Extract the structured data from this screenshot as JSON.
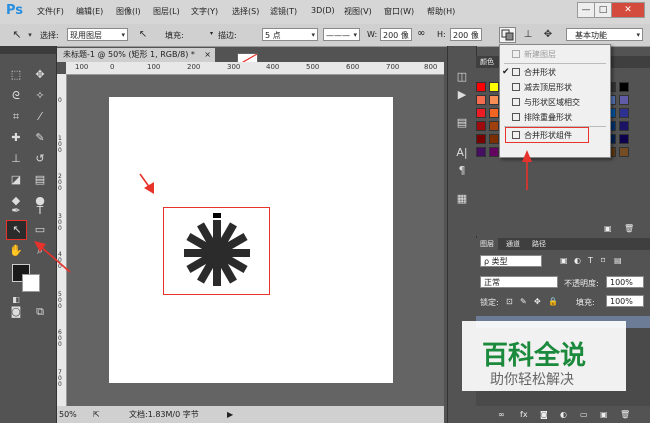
{
  "app": {
    "logo": "Ps"
  },
  "menubar": {
    "items": [
      "文件(F)",
      "编辑(E)",
      "图像(I)",
      "图层(L)",
      "文字(Y)",
      "选择(S)",
      "滤镜(T)",
      "3D(D)",
      "视图(V)",
      "窗口(W)",
      "帮助(H)"
    ],
    "window_controls": {
      "minimize": "—",
      "restore": "□",
      "close": "✕"
    }
  },
  "options_bar": {
    "select_label": "选择:",
    "select_value": "现用图层",
    "fill_label": "填充:",
    "stroke_label": "描边:",
    "stroke_size": "5 点",
    "stroke_style": "———",
    "w_label": "W:",
    "w_value": "200 像",
    "h_label": "H:",
    "h_value": "200 像",
    "workspace": "基本功能"
  },
  "path_ops_menu": {
    "items": [
      {
        "label": "新建图层",
        "disabled": true,
        "checked": false
      },
      {
        "label": "合并形状",
        "disabled": false,
        "checked": true
      },
      {
        "label": "减去顶层形状",
        "disabled": false,
        "checked": false
      },
      {
        "label": "与形状区域相交",
        "disabled": false,
        "checked": false
      },
      {
        "label": "排除重叠形状",
        "disabled": false,
        "checked": false
      },
      {
        "label": "合并形状组件",
        "disabled": false,
        "checked": false
      }
    ]
  },
  "document": {
    "tab_title": "未标题-1 @ 50% (矩形 1, RGB/8) *",
    "tab_close": "×",
    "ruler_top": [
      "100",
      "0",
      "100",
      "200",
      "300",
      "400",
      "500",
      "600",
      "700",
      "800"
    ],
    "ruler_left": [
      "0",
      "100",
      "200",
      "300",
      "400",
      "500",
      "600",
      "700"
    ],
    "zoom": "50%",
    "doc_info": "文档:1.83M/0 字节"
  },
  "swatches": {
    "tab_label": "颜色",
    "colors": [
      "#ff0000",
      "#ffff00",
      "#00ff00",
      "#00ffff",
      "#0000ff",
      "#ff00ff",
      "#ffffff",
      "#cccccc",
      "#999999",
      "#666666",
      "#333333",
      "#000000",
      "#f26c4f",
      "#f68e55",
      "#fbaf5c",
      "#fff467",
      "#acd372",
      "#7cc576",
      "#3bb878",
      "#1abbb4",
      "#00bff3",
      "#438cca",
      "#5574b9",
      "#605ca8",
      "#ed1c24",
      "#f26522",
      "#f7941d",
      "#fff200",
      "#8dc73f",
      "#39b54a",
      "#00a651",
      "#00a99d",
      "#00aeef",
      "#0072bc",
      "#0054a6",
      "#2e3192",
      "#9e0b0f",
      "#a0410d",
      "#a3620a",
      "#aba000",
      "#598527",
      "#1a7b30",
      "#007236",
      "#00746b",
      "#0076a3",
      "#004b80",
      "#003471",
      "#1b1464",
      "#790000",
      "#7b2e00",
      "#7d4900",
      "#827b00",
      "#406618",
      "#005e20",
      "#005826",
      "#005952",
      "#005b7f",
      "#003663",
      "#002157",
      "#0d004c",
      "#440e62",
      "#630460",
      "#9e005d",
      "#9e0039",
      "#a3d39c",
      "#7da7d9",
      "#c4df9b",
      "#fdc689",
      "#c69c6d",
      "#8c6239",
      "#603913",
      "#754c24"
    ]
  },
  "layers": {
    "tabs": [
      "图层",
      "通道",
      "路径"
    ],
    "filter_label": "ρ 类型",
    "blend_mode": "正常",
    "opacity_label": "不透明度:",
    "opacity_value": "100%",
    "lock_label": "锁定:",
    "fill_label": "填充:",
    "fill_value": "100%"
  },
  "watermark": {
    "big": "百科全说",
    "small": "助你轻松解决"
  },
  "accent": {
    "annotation_red": "#e8322c",
    "ps_blue": "#2a8ee0",
    "watermark_green": "#1c8a3c"
  }
}
